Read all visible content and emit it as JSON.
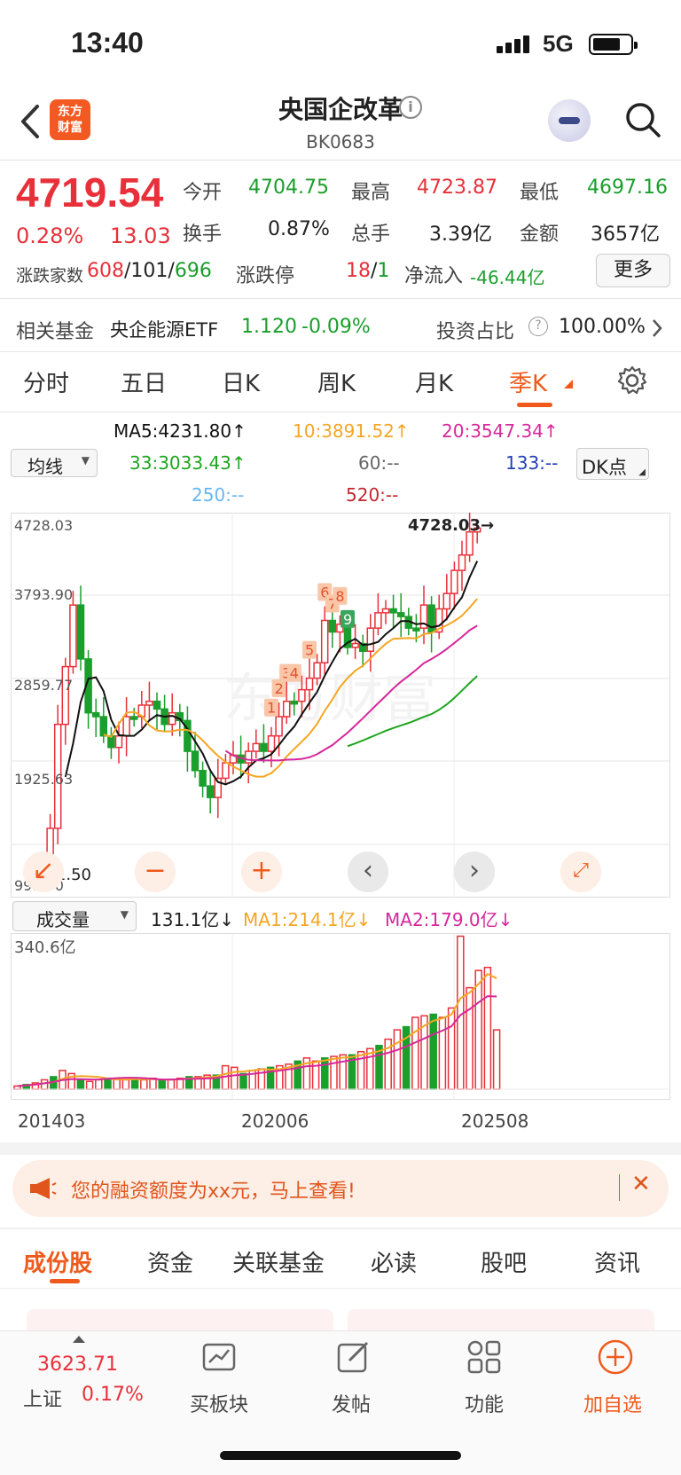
{
  "status": {
    "time": "13:40",
    "network": "5G"
  },
  "header": {
    "logo_line1": "东方",
    "logo_line2": "财富",
    "title": "央国企改革",
    "code": "BK0683"
  },
  "quote": {
    "price": "4719.54",
    "change_pct": "0.28%",
    "change": "13.03",
    "open_label": "今开",
    "open": "4704.75",
    "high_label": "最高",
    "high": "4723.87",
    "low_label": "最低",
    "low": "4697.16",
    "turnover_label": "换手",
    "turnover": "0.87%",
    "volume_label": "总手",
    "volume": "3.39亿",
    "amount_label": "金额",
    "amount": "3657亿",
    "breadth_label": "涨跌家数",
    "breadth_up": "608",
    "breadth_flat": "101",
    "breadth_down": "696",
    "limit_label": "涨跌停",
    "limit_up": "18",
    "limit_down": "1",
    "netflow_label": "净流入",
    "netflow": "-46.44亿",
    "more": "更多"
  },
  "fund": {
    "label": "相关基金",
    "name": "央企能源ETF",
    "price": "1.120",
    "pct": "-0.09%",
    "ratio_label": "投资占比",
    "ratio": "100.00%"
  },
  "tabs": [
    "分时",
    "五日",
    "日K",
    "周K",
    "月K",
    "季K"
  ],
  "active_tab": "季K",
  "ma": {
    "selector": "均线",
    "ma5": "MA5:4231.80↑",
    "ma10": "10:3891.52↑",
    "ma20": "20:3547.34↑",
    "ma33": "33:3033.43↑",
    "ma60": "60:--",
    "ma133": "133:--",
    "ma250": "250:--",
    "ma520": "520:--",
    "dk": "DK点"
  },
  "colors": {
    "up": "#e8303a",
    "down": "#1a9e2c",
    "ma5": "#111111",
    "ma10": "#f5a623",
    "ma20": "#d6289a",
    "ma33": "#1fa51f",
    "accent": "#ef5a1c"
  },
  "kline": {
    "y_ticks": [
      "4728.03",
      "3793.90",
      "2859.77",
      "1925.63",
      "991.50"
    ],
    "max_label": "4728.03→",
    "min_label": "991.50",
    "signals": [
      "1",
      "2",
      "3",
      "4",
      "5",
      "6",
      "7",
      "8",
      "9"
    ],
    "watermark": "东方财富"
  },
  "volume": {
    "selector": "成交量",
    "current": "131.1亿↓",
    "ma1": "MA1:214.1亿↓",
    "ma2": "MA2:179.0亿↓",
    "max_label": "340.6亿",
    "x_labels": [
      "201403",
      "202006",
      "202508"
    ]
  },
  "banner": {
    "text": "您的融资额度为xx元，马上查看!"
  },
  "bottom_tabs": [
    "成份股",
    "资金",
    "关联基金",
    "必读",
    "股吧",
    "资讯"
  ],
  "bottom_nav": {
    "index_value": "3623.71",
    "index_name": "上证",
    "index_pct": "0.17%",
    "items": [
      "买板块",
      "发帖",
      "功能",
      "加自选"
    ]
  }
}
